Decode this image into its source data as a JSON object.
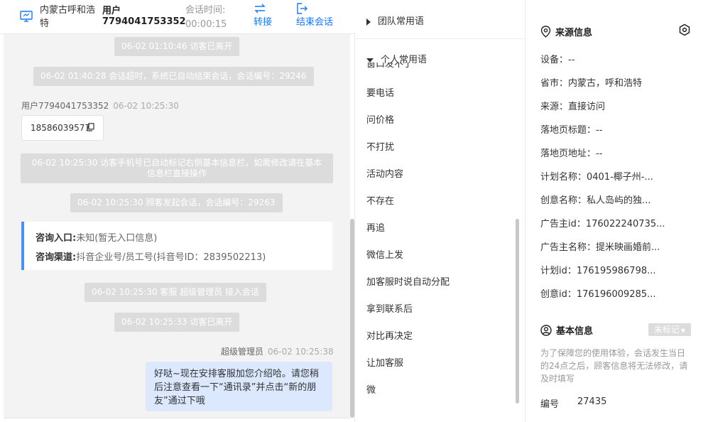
{
  "header": {
    "location": "内蒙古呼和浩特",
    "user_line1": "用户",
    "user_line2": "7794041753352",
    "time_label": "会话时间:",
    "time_value": "00:00:15",
    "transfer_label": "转接",
    "end_label": "结束会话"
  },
  "chat": {
    "sys1": "06-02 01:10:46 访客已离开",
    "sys2": "06-02 01:40:28 会话超时，系统已自动结束会话，会话编号：29246",
    "visitor_name": "用户7794041753352",
    "visitor_time": "06-02 10:25:30",
    "phone": "18586039577",
    "sys3": "06-02 10:25:30 访客手机号已自动标记右侧基本信息栏，如需修改请在基本信息栏直接操作",
    "sys4": "06-02 10:25:30 顾客发起会话，会话编号：29263",
    "entry_label": "咨询入口:",
    "entry_value": "未知(暂无入口信息)",
    "channel_label": "咨询渠道:",
    "channel_value": "抖音企业号/员工号(抖音号ID：2839502213)",
    "sys5": "06-02 10:25:30 客服 超级管理员 接入会话",
    "sys6": "06-02 10:25:33 访客已离开",
    "agent_name": "超级管理员",
    "agent_time": "06-02 10:25:38",
    "agent_message": "好哒~现在安排客服加您介绍哈。请您稍后注意查看一下“通讯录”并点击“新的朋友”通过下哦"
  },
  "quick_replies": {
    "team_label": "团队常用语",
    "personal_label": "个人常用语",
    "clipped_item": "窗口发不了",
    "items": [
      "要电话",
      "问价格",
      "不打扰",
      "活动内容",
      "不存在",
      "再追",
      "微信上发",
      "加客服时说自动分配",
      "拿到联系后",
      "对比再决定",
      "让加客服",
      "微"
    ]
  },
  "source_info": {
    "title": "来源信息",
    "rows": [
      "设备：--",
      "省市：内蒙古，呼和浩特",
      "来源：直接访问",
      "落地页标题：--",
      "落地页地址：--",
      "计划名称：0401-椰子州-...",
      "创意名称：私人岛屿的独...",
      "广告主id：176022240735...",
      "广告主名称：提米映画婚前...",
      "计划id：176195986798...",
      "创意id：176196009285..."
    ]
  },
  "basic_info": {
    "title": "基本信息",
    "tag_label": "未标记",
    "notice": "为了保障您的使用体验，会话发生当日的24点之后，顾客信息将无法修改，请及时填写",
    "id_label": "编号",
    "id_value": "27435"
  },
  "colors": {
    "accent": "#1677ff",
    "bubble": "#dbe8fd",
    "system_pill": "#dcdcdc",
    "card_border": "#4a8fff"
  }
}
